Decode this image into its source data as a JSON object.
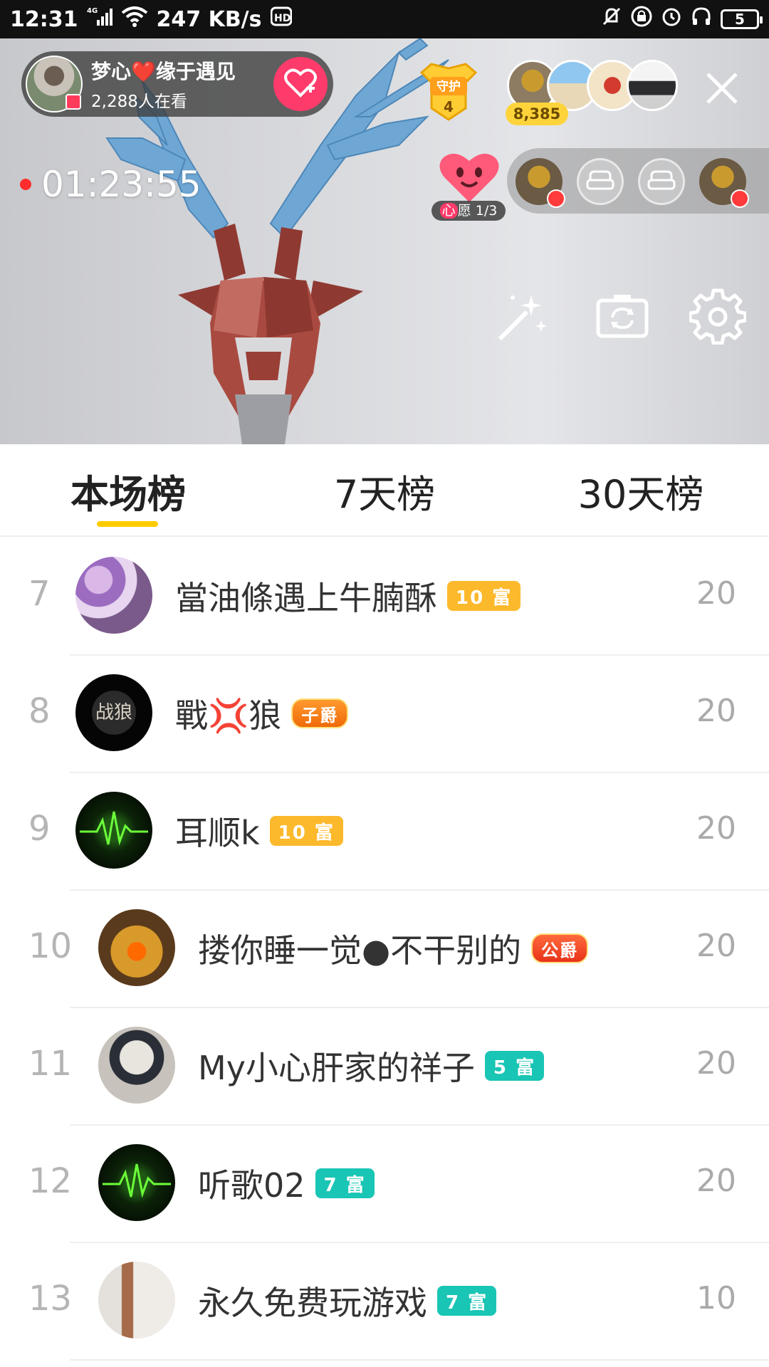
{
  "status_bar": {
    "time": "12:31",
    "net_speed": "247 KB/s",
    "battery": "5"
  },
  "live": {
    "host_name": "梦心❤️缘于遇见",
    "viewers": "2,288人在看",
    "guard_count": "4",
    "fan_total": "8,385",
    "timer": "01:23:55",
    "wish_prefix": "心",
    "wish_text": "愿 1/3"
  },
  "tabs": [
    {
      "label": "本场榜",
      "active": true
    },
    {
      "label": "7天榜",
      "active": false
    },
    {
      "label": "30天榜",
      "active": false
    }
  ],
  "ranking": [
    {
      "rank": "7",
      "name": "當油條遇上牛腩酥",
      "badge": "10 富",
      "badge_style": "yellow",
      "score": "20",
      "avatar": "flowers"
    },
    {
      "rank": "8",
      "name": "戰💢狼",
      "badge": "子爵",
      "badge_style": "noble",
      "score": "20",
      "avatar": "dark"
    },
    {
      "rank": "9",
      "name": "耳顺k",
      "badge": "10 富",
      "badge_style": "yellow",
      "score": "20",
      "avatar": "pulse"
    },
    {
      "rank": "10",
      "name": "搂你睡一觉●不干别的",
      "badge": "公爵",
      "badge_style": "noble-red",
      "score": "20",
      "avatar": "autumn"
    },
    {
      "rank": "11",
      "name": "My小心肝家的祥子",
      "badge": "5 富",
      "badge_style": "teal",
      "score": "20",
      "avatar": "child"
    },
    {
      "rank": "12",
      "name": "听歌02",
      "badge": "7 富",
      "badge_style": "teal",
      "score": "20",
      "avatar": "pulse"
    },
    {
      "rank": "13",
      "name": "永久免费玩游戏",
      "badge": "7 富",
      "badge_style": "teal",
      "score": "10",
      "avatar": "room"
    }
  ],
  "colors": {
    "tab_indicator": "#ffcc00",
    "badge_yellow": "#fdb92c",
    "badge_teal": "#19c5b4",
    "rank_text": "#b5b5b5",
    "follow_button": "#ff3b6b"
  },
  "icons": [
    "signal-icon",
    "wifi-icon",
    "hd-icon",
    "mute-icon",
    "lock-icon",
    "alarm-icon",
    "headphones-icon",
    "battery-icon",
    "heart-plus-icon",
    "close-icon",
    "magic-wand-icon",
    "camera-flip-icon",
    "settings-gear-icon",
    "seat-icon"
  ]
}
